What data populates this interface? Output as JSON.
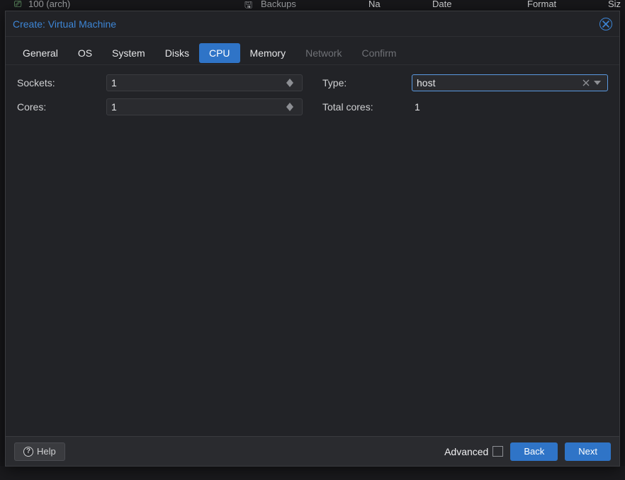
{
  "background": {
    "tree_item": "100 (arch)",
    "menu_item": "Backups",
    "cols": {
      "name": "Na",
      "date": "Date",
      "format": "Format",
      "size": "Siz"
    }
  },
  "dialog": {
    "title": "Create: Virtual Machine",
    "close_title": "Close"
  },
  "tabs": {
    "general": "General",
    "os": "OS",
    "system": "System",
    "disks": "Disks",
    "cpu": "CPU",
    "memory": "Memory",
    "network": "Network",
    "confirm": "Confirm"
  },
  "form": {
    "sockets": {
      "label": "Sockets:",
      "value": "1"
    },
    "cores": {
      "label": "Cores:",
      "value": "1"
    },
    "type": {
      "label": "Type:",
      "value": "host"
    },
    "total": {
      "label": "Total cores:",
      "value": "1"
    }
  },
  "footer": {
    "help": "Help",
    "advanced": "Advanced",
    "advanced_checked": false,
    "back": "Back",
    "next": "Next"
  }
}
